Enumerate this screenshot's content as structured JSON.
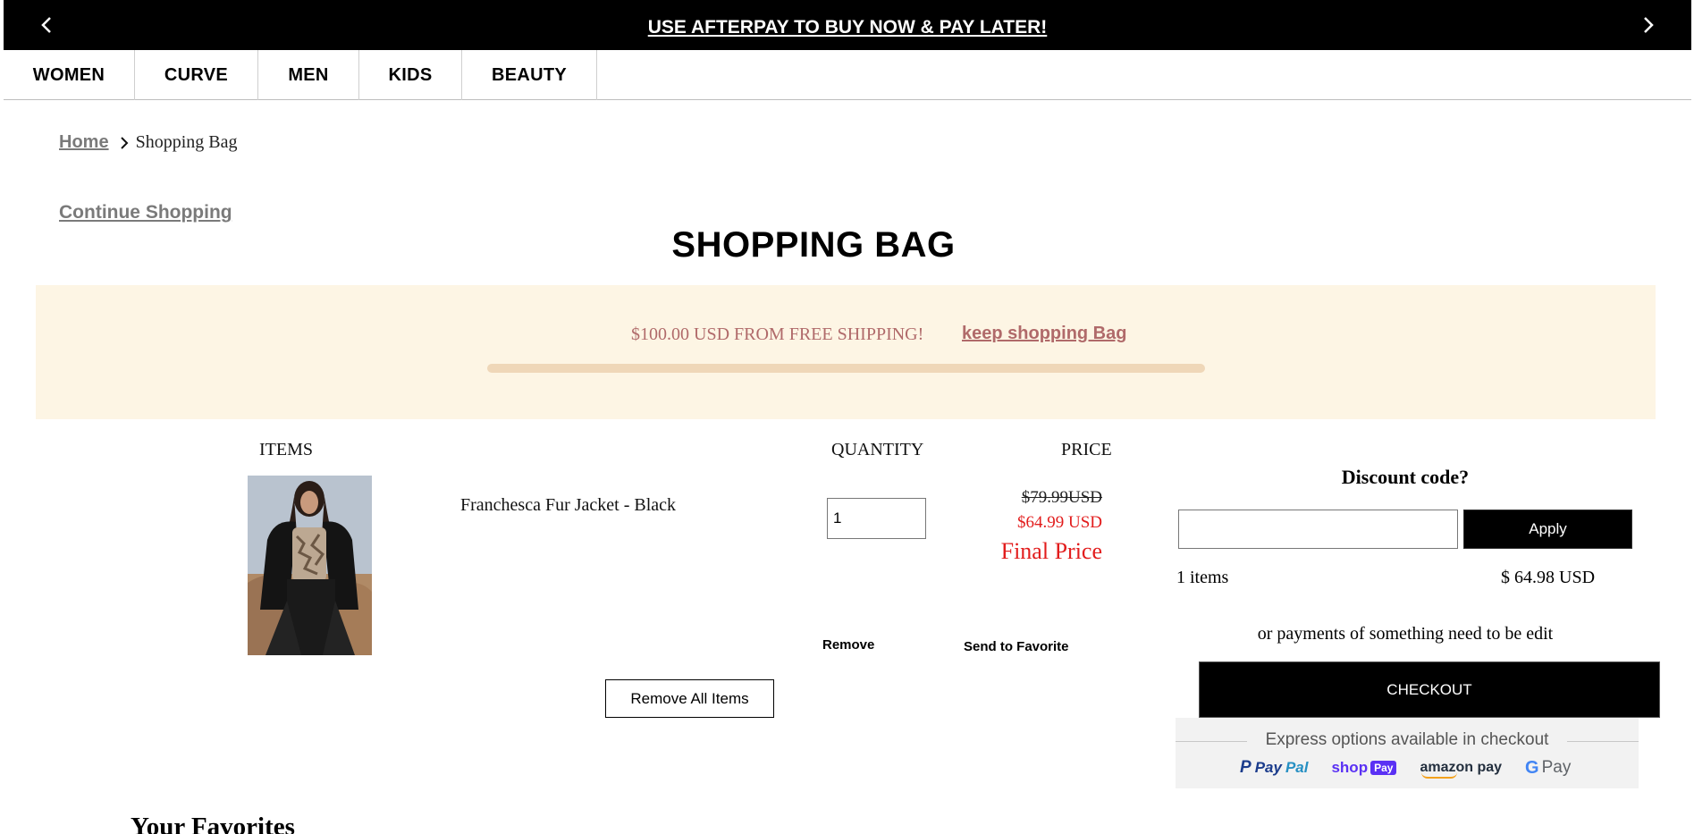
{
  "promo": {
    "text": "USE AFTERPAY TO BUY NOW & PAY LATER!"
  },
  "nav": {
    "items": [
      {
        "label": "WOMEN"
      },
      {
        "label": "CURVE"
      },
      {
        "label": "MEN"
      },
      {
        "label": "KIDS"
      },
      {
        "label": "BEAUTY"
      }
    ]
  },
  "breadcrumb": {
    "home": "Home",
    "current": "Shopping Bag"
  },
  "continue_label": "Continue Shopping",
  "page_title": "SHOPPING BAG",
  "shipping": {
    "message": "$100.00 USD FROM FREE SHIPPING!",
    "link": "keep shopping Bag",
    "progress_fraction": 0.0
  },
  "columns": {
    "items": "ITEMS",
    "quantity": "QUANTITY",
    "price": "PRICE"
  },
  "product": {
    "name": "Franchesca Fur Jacket - Black",
    "quantity": "1",
    "price_old": "$79.99USD",
    "price_new": "$64.99 USD",
    "price_note": "Final Price",
    "remove": "Remove",
    "send_favorite": "Send to Favorite"
  },
  "remove_all_label": "Remove All Items",
  "summary": {
    "discount_title": "Discount code?",
    "discount_value": "",
    "apply_label": "Apply",
    "items_count": "1 items",
    "items_total": "$ 64.98 USD",
    "payments_note": "or payments of something need to be edit",
    "checkout_label": "CHECKOUT"
  },
  "express": {
    "title": "Express options available in checkout",
    "paypal_a": "Pay",
    "paypal_b": "Pal",
    "shoppay_a": "shop",
    "shoppay_b": "Pay",
    "amazon": "amazon pay",
    "gpay": "Pay"
  },
  "favorites_title": "Your Favorites",
  "colors": {
    "banner_bg": "#fdf5e4",
    "banner_text": "#b06a6a",
    "sale_red": "#e21c1c",
    "link_gray": "#7a7a7a"
  }
}
